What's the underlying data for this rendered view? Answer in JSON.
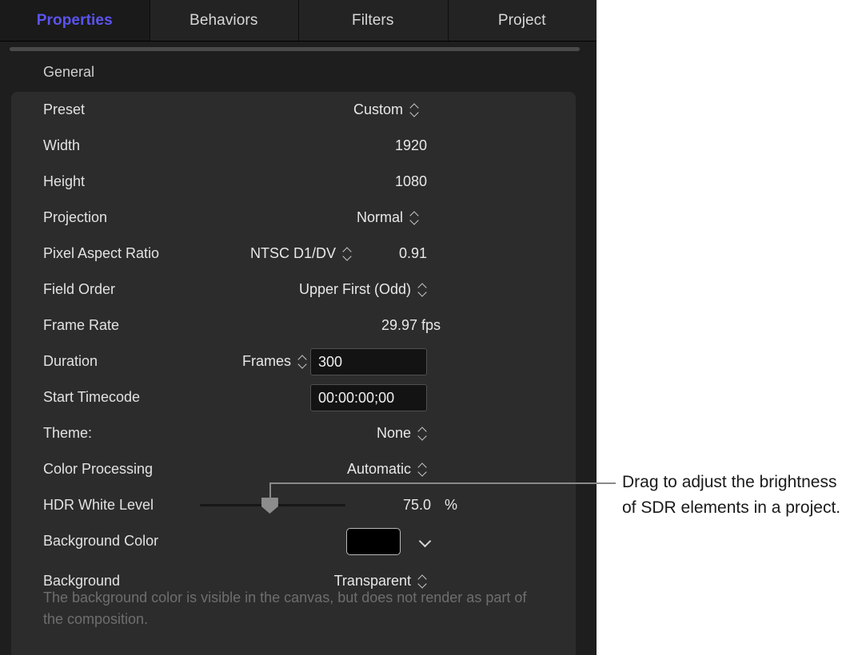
{
  "tabs": [
    {
      "label": "Properties",
      "selected": true
    },
    {
      "label": "Behaviors",
      "selected": false
    },
    {
      "label": "Filters",
      "selected": false
    },
    {
      "label": "Project",
      "selected": false
    }
  ],
  "section": {
    "title": "General"
  },
  "rows": {
    "preset": {
      "label": "Preset",
      "value": "Custom"
    },
    "width": {
      "label": "Width",
      "value": "1920"
    },
    "height": {
      "label": "Height",
      "value": "1080"
    },
    "projection": {
      "label": "Projection",
      "value": "Normal"
    },
    "pixel_aspect": {
      "label": "Pixel Aspect Ratio",
      "value": "NTSC D1/DV",
      "ratio": "0.91"
    },
    "field_order": {
      "label": "Field Order",
      "value": "Upper First (Odd)"
    },
    "frame_rate": {
      "label": "Frame Rate",
      "value": "29.97 fps"
    },
    "duration": {
      "label": "Duration",
      "units": "Frames",
      "value": "300"
    },
    "start_timecode": {
      "label": "Start Timecode",
      "value": "00:00:00;00"
    },
    "theme": {
      "label": "Theme:",
      "value": "None"
    },
    "color_proc": {
      "label": "Color Processing",
      "value": "Automatic"
    },
    "hdr_white": {
      "label": "HDR White Level",
      "value": "75.0",
      "unit": "%",
      "percent": 48
    },
    "bg_color": {
      "label": "Background Color",
      "swatch": "#000000"
    },
    "background": {
      "label": "Background",
      "value": "Transparent"
    }
  },
  "help_text": "The background color is visible in the canvas, but does not render as part of the composition.",
  "callout": {
    "text": "Drag to adjust the brightness of SDR elements in a project."
  },
  "colors": {
    "accent": "#5b54f0",
    "panel": "#2c2c2c",
    "window": "#1e1e1e",
    "tab_selected_bg": "#1a1a1a",
    "tab_bg": "#232323",
    "field_bg": "#131313",
    "callout_line": "#8a8a8a"
  }
}
